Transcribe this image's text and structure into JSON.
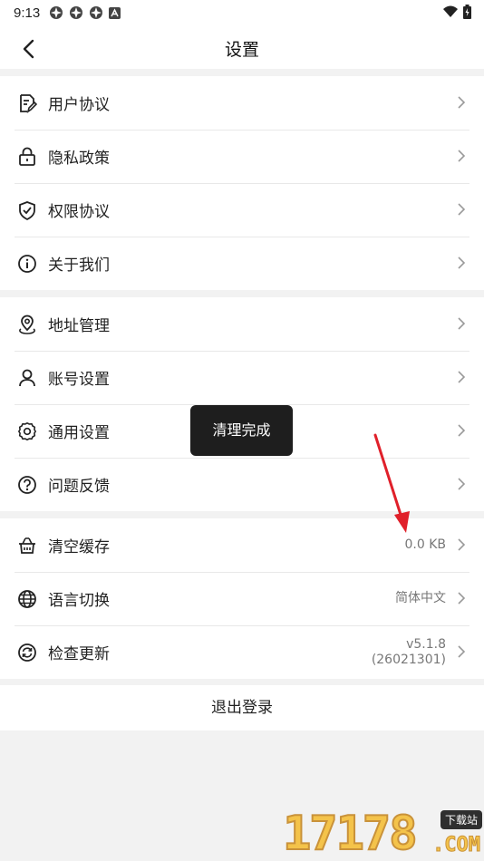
{
  "status_bar": {
    "time": "9:13",
    "notification_icons": [
      "notification-icon",
      "notification-icon",
      "notification-icon",
      "text-notification-icon"
    ],
    "system_icons": [
      "wifi-icon",
      "battery-icon"
    ]
  },
  "nav": {
    "title": "设置",
    "back_icon": "back-arrow-icon"
  },
  "group1": [
    {
      "label": "用户协议",
      "icon": "document-edit-icon"
    },
    {
      "label": "隐私政策",
      "icon": "lock-icon"
    },
    {
      "label": "权限协议",
      "icon": "shield-check-icon"
    },
    {
      "label": "关于我们",
      "icon": "info-circle-icon"
    }
  ],
  "group2": [
    {
      "label": "地址管理",
      "icon": "location-pin-icon"
    },
    {
      "label": "账号设置",
      "icon": "user-icon"
    },
    {
      "label": "通用设置",
      "icon": "gear-icon"
    },
    {
      "label": "问题反馈",
      "icon": "question-circle-icon"
    }
  ],
  "group3": [
    {
      "label": "清空缓存",
      "icon": "broom-basket-icon",
      "value": "0.0 KB"
    },
    {
      "label": "语言切换",
      "icon": "globe-icon",
      "value": "简体中文"
    },
    {
      "label": "检查更新",
      "icon": "refresh-icon",
      "value_line1": "v5.1.8",
      "value_line2": "(26021301)"
    }
  ],
  "logout_label": "退出登录",
  "toast": {
    "text": "清理完成"
  },
  "annotation": {
    "color": "#e0202a"
  },
  "watermark": {
    "number": "17178",
    "badge": "下载站",
    "suffix": ".COM"
  }
}
